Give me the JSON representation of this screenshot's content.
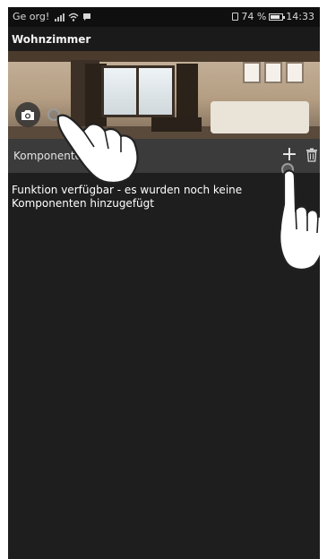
{
  "status_bar": {
    "carrier": "Ge org!",
    "battery_percent": "74 %",
    "time": "14:33"
  },
  "app_bar": {
    "title": "Wohnzimmer"
  },
  "components": {
    "label": "Komponenten",
    "empty_message": "Funktion verfügbar - es wurden noch keine Komponenten hinzugefügt",
    "add_icon": "plus-icon",
    "delete_icon": "trash-icon"
  },
  "overlay": {
    "camera_icon": "camera-icon",
    "hand_icon": "pointing-hand-icon"
  },
  "colors": {
    "background": "#1e1e1e",
    "section_bar": "#3b3b3b",
    "status_bar": "#0f0f0f",
    "text": "#ffffff"
  }
}
